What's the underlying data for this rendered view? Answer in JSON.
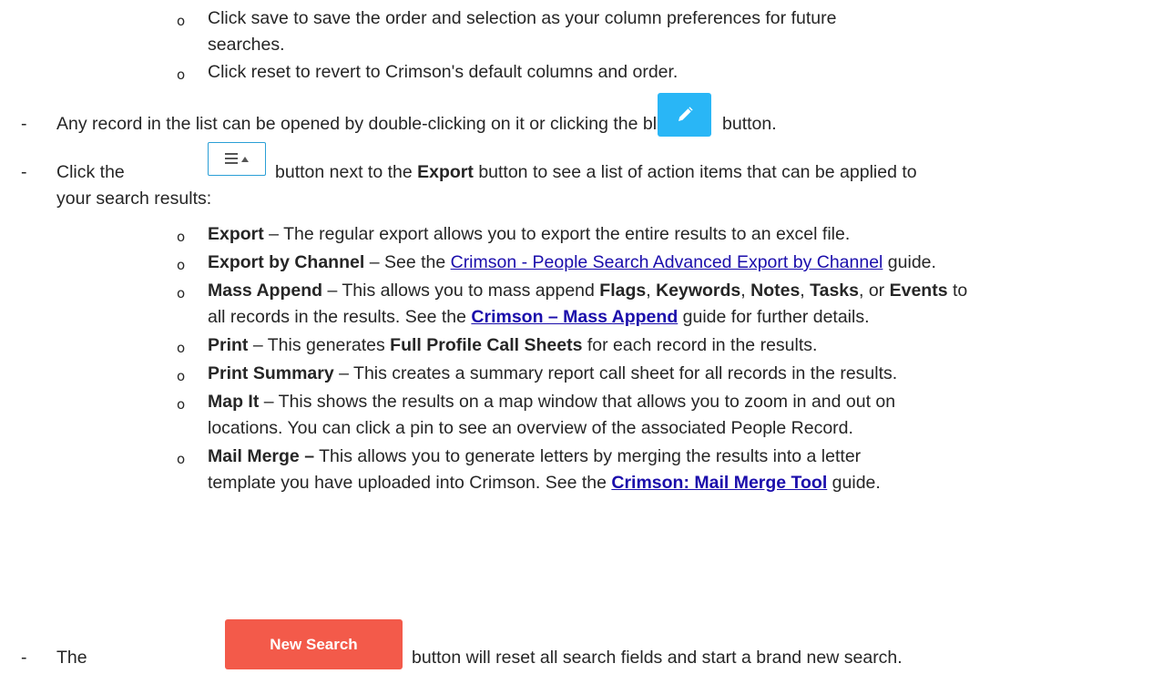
{
  "column_prefs": {
    "bullet": "o",
    "save_line_1": "Click save to save the order and selection as your column preferences for future",
    "save_line_2": "searches.",
    "reset_line": "Click reset to revert to Crimson's default columns and order."
  },
  "open_record": {
    "dash": "-",
    "before": "Any record in the list can be opened by double-clicking on it or clicking the blue",
    "after": "button.",
    "icon": "pencil-icon",
    "button_color": "#29b6f6"
  },
  "actions_menu": {
    "dash": "-",
    "before": "Click the",
    "after": "button next to the",
    "export_word": "Export",
    "after_export": "button to see a list of action items that can be applied to",
    "line_2": "your search results:",
    "icon": "hamburger-caret-icon",
    "border_color": "#2a9fd6"
  },
  "items": {
    "export": {
      "term": "Export",
      "desc": " – The regular export allows you to export the entire results to an excel file."
    },
    "export_channel": {
      "term": "Export by Channel",
      "desc_before": " – See the ",
      "link": "Crimson - People Search Advanced Export by Channel",
      "desc_after": " guide."
    },
    "mass_append": {
      "term": "Mass Append",
      "desc_1": " – This allows you to mass append ",
      "flags": "Flags",
      "comma_1": ", ",
      "keywords": "Keywords",
      "comma_2": ", ",
      "notes": "Notes",
      "comma_3": ", ",
      "tasks": "Tasks",
      "or": ", or ",
      "events": "Events",
      "to": " to",
      "line_2_before": "all records in the results. See the ",
      "link": "Crimson – Mass Append",
      "line_2_after": " guide for further details."
    },
    "print": {
      "term": "Print",
      "desc_before": " – This generates ",
      "bold": "Full Profile Call Sheets",
      "desc_after": " for each record in the results."
    },
    "print_summary": {
      "term": "Print Summary",
      "desc": " – This creates a summary report call sheet for all records in the results."
    },
    "map_it": {
      "term": "Map It",
      "desc_1": " – This shows the results on a map window that allows you to zoom in and out on",
      "line_2": "locations. You can click a pin to see an overview of the associated People Record."
    },
    "mail_merge": {
      "term": "Mail Merge –",
      "desc_1": " This allows you to generate letters by merging the results into a letter",
      "line_2_before": "template you have uploaded into Crimson.  See the ",
      "link": "Crimson: Mail Merge Tool",
      "line_2_after": " guide."
    }
  },
  "new_search": {
    "dash": "-",
    "before": "The",
    "button_label": "New Search",
    "after": "button will reset all search fields and start a brand new search.",
    "button_color": "#f35a4a"
  }
}
